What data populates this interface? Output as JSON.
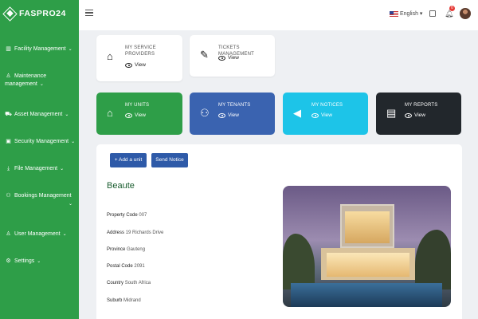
{
  "brand": {
    "name": "FASPRO24"
  },
  "sidebar": {
    "items": [
      {
        "label": "Facility Management",
        "icon": "building-icon"
      },
      {
        "label": "Maintenance management",
        "icon": "person-icon"
      },
      {
        "label": "Asset Management",
        "icon": "cart-icon"
      },
      {
        "label": "Security Management",
        "icon": "lock-icon"
      },
      {
        "label": "File Management",
        "icon": "download-icon"
      },
      {
        "label": "Bookings Management",
        "icon": "people-icon"
      },
      {
        "label": "User Management",
        "icon": "person-icon"
      },
      {
        "label": "Settings",
        "icon": "gear-icon"
      }
    ]
  },
  "topbar": {
    "language": "English",
    "notification_count": "0"
  },
  "cards_top": [
    {
      "title": "MY SERVICE PROVIDERS",
      "view": "View"
    },
    {
      "title": "TICKETS MANAGEMENT",
      "view": "View"
    }
  ],
  "cards_colored": [
    {
      "title": "MY UNITS",
      "view": "View",
      "color": "#2e9e48"
    },
    {
      "title": "MY TENANTS",
      "view": "View",
      "color": "#3a63b0"
    },
    {
      "title": "MY NOTICES",
      "view": "View",
      "color": "#1dc4e8"
    },
    {
      "title": "MY REPORTS",
      "view": "View",
      "color": "#22272c"
    }
  ],
  "actions": {
    "add_unit": "+ Add a unit",
    "send_notice": "Send Notice"
  },
  "property": {
    "name": "Beaute",
    "fields": [
      {
        "key": "Property Code",
        "value": "007"
      },
      {
        "key": "Address",
        "value": "19 Richards Drive"
      },
      {
        "key": "Province",
        "value": "Gauteng"
      },
      {
        "key": "Postal Code",
        "value": "2091"
      },
      {
        "key": "Country",
        "value": "South Africa"
      },
      {
        "key": "Suburb",
        "value": "Midrand"
      }
    ]
  }
}
